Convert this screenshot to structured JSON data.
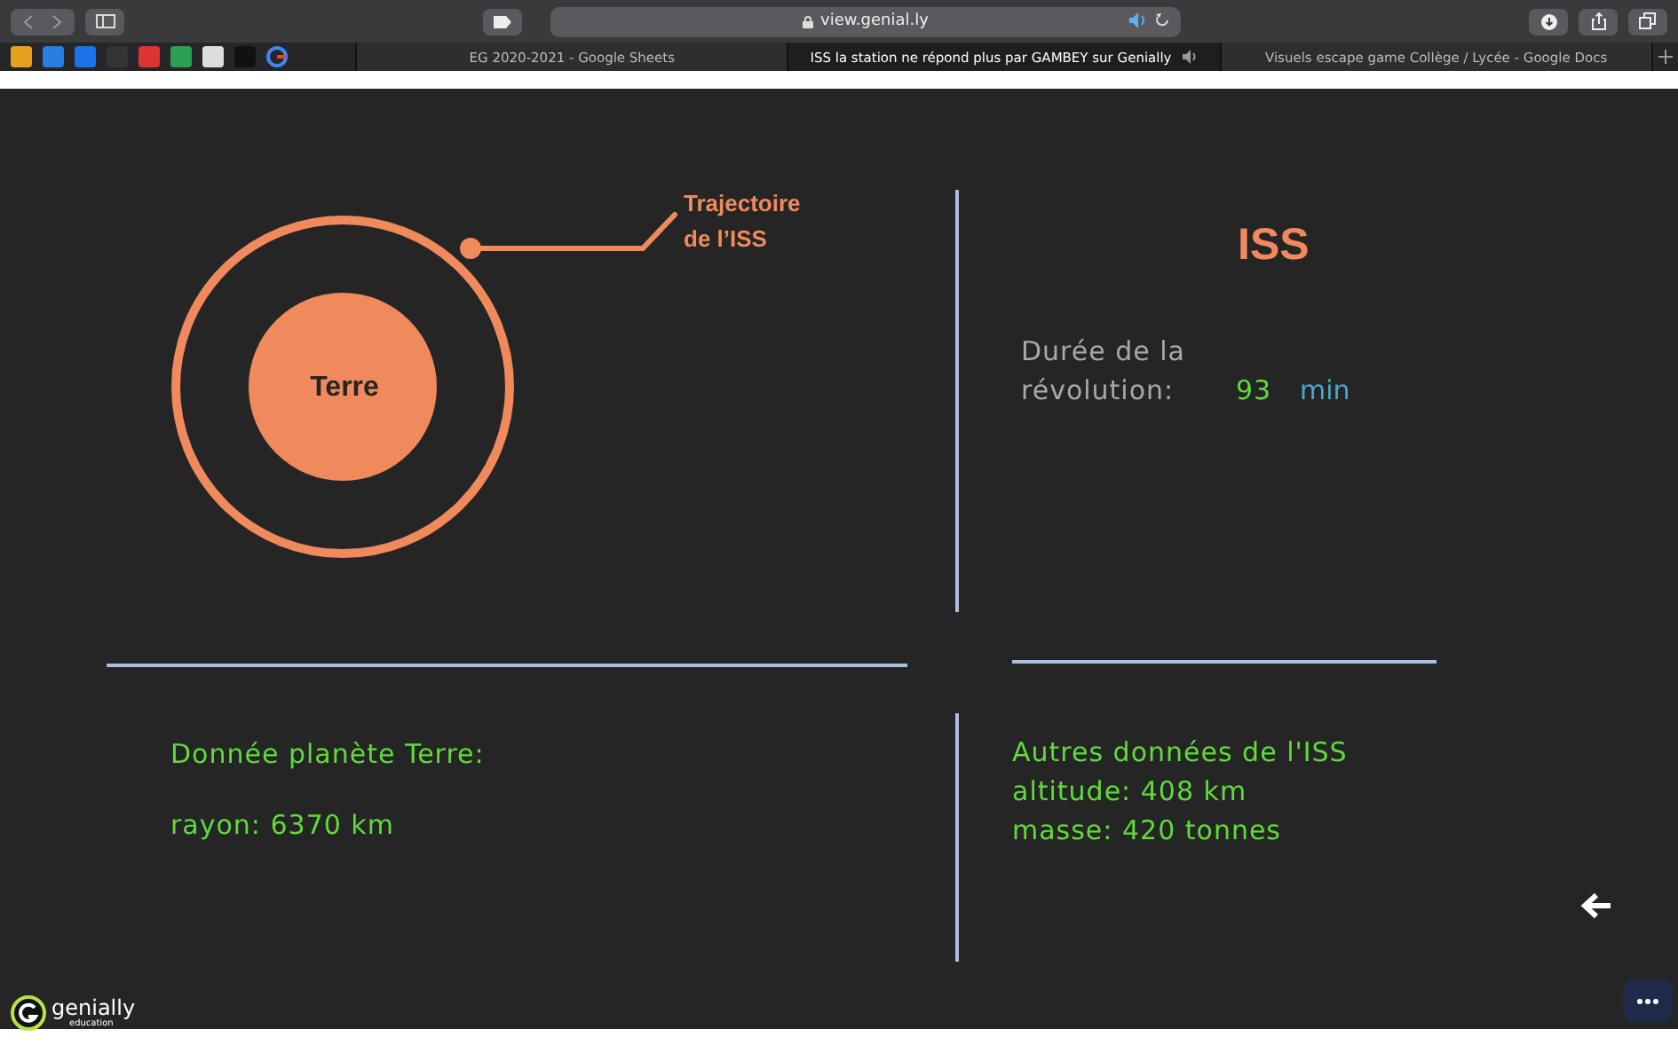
{
  "browser": {
    "address": "view.genial.ly",
    "tabs": [
      {
        "label": "EG 2020-2021 - Google Sheets",
        "selected": false
      },
      {
        "label": "ISS la station ne répond plus par GAMBEY sur Genially",
        "selected": true
      },
      {
        "label": "Visuels escape game Collège / Lycée - Google Docs",
        "selected": false
      }
    ]
  },
  "slide": {
    "diagram": {
      "planet": "Terre",
      "orbit_label": "Trajectoire de l’ISS"
    },
    "iss_panel": {
      "title": "ISS",
      "label": "Durée de la révolution:",
      "value": "93",
      "unit": "min"
    },
    "earth_data": {
      "title": "Donnée planète Terre:",
      "lines": [
        "rayon: 6370 km"
      ]
    },
    "iss_data": {
      "title": "Autres données de l'ISS",
      "lines": [
        "altitude: 408 km",
        "masse: 420 tonnes"
      ]
    }
  },
  "footer": {
    "brand": "genially",
    "subtitle": "education"
  }
}
